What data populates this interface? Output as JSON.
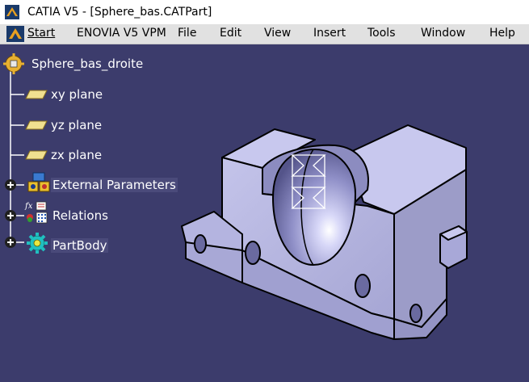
{
  "window": {
    "title": "CATIA V5 - [Sphere_bas.CATPart]"
  },
  "menu": {
    "start": "Start",
    "enovia": "ENOVIA V5 VPM",
    "file": "File",
    "edit": "Edit",
    "view": "View",
    "insert": "Insert",
    "tools": "Tools",
    "window": "Window",
    "help": "Help"
  },
  "tree": {
    "root": "Sphere_bas_droite",
    "items": [
      {
        "label": "xy plane",
        "icon": "plane-icon"
      },
      {
        "label": "yz plane",
        "icon": "plane-icon"
      },
      {
        "label": "zx plane",
        "icon": "plane-icon"
      },
      {
        "label": "External Parameters",
        "icon": "parameters-icon"
      },
      {
        "label": "Relations",
        "icon": "relations-icon"
      },
      {
        "label": "PartBody",
        "icon": "partbody-icon"
      }
    ]
  },
  "colors": {
    "background": "#3c3c6c",
    "part_face": "#b6b6e0",
    "part_edge": "#000000",
    "tree_line": "#ffffff"
  }
}
